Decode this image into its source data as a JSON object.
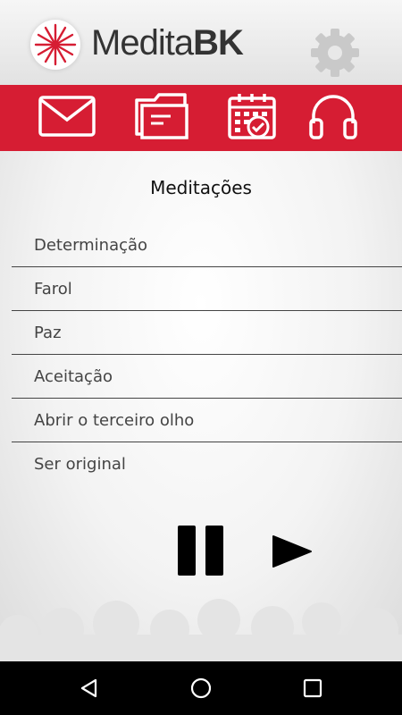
{
  "app": {
    "title_regular": "Medita",
    "title_bold": "BK"
  },
  "header_icons": {
    "logo": "meditabk-logo",
    "settings": "gear-icon"
  },
  "toolbar": {
    "background": "#d61d33",
    "items": [
      {
        "icon": "envelope-icon"
      },
      {
        "icon": "folder-icon"
      },
      {
        "icon": "calendar-icon"
      },
      {
        "icon": "headphones-icon"
      }
    ]
  },
  "main": {
    "section_title": "Meditações",
    "meditations": [
      "Determinação",
      "Farol",
      "Paz",
      "Aceitação",
      "Abrir o terceiro olho",
      "Ser original"
    ]
  },
  "player": {
    "pause_icon": "pause-icon",
    "play_icon": "play-icon"
  },
  "system_nav": {
    "back": "back-icon",
    "home": "home-icon",
    "recents": "recents-icon"
  }
}
